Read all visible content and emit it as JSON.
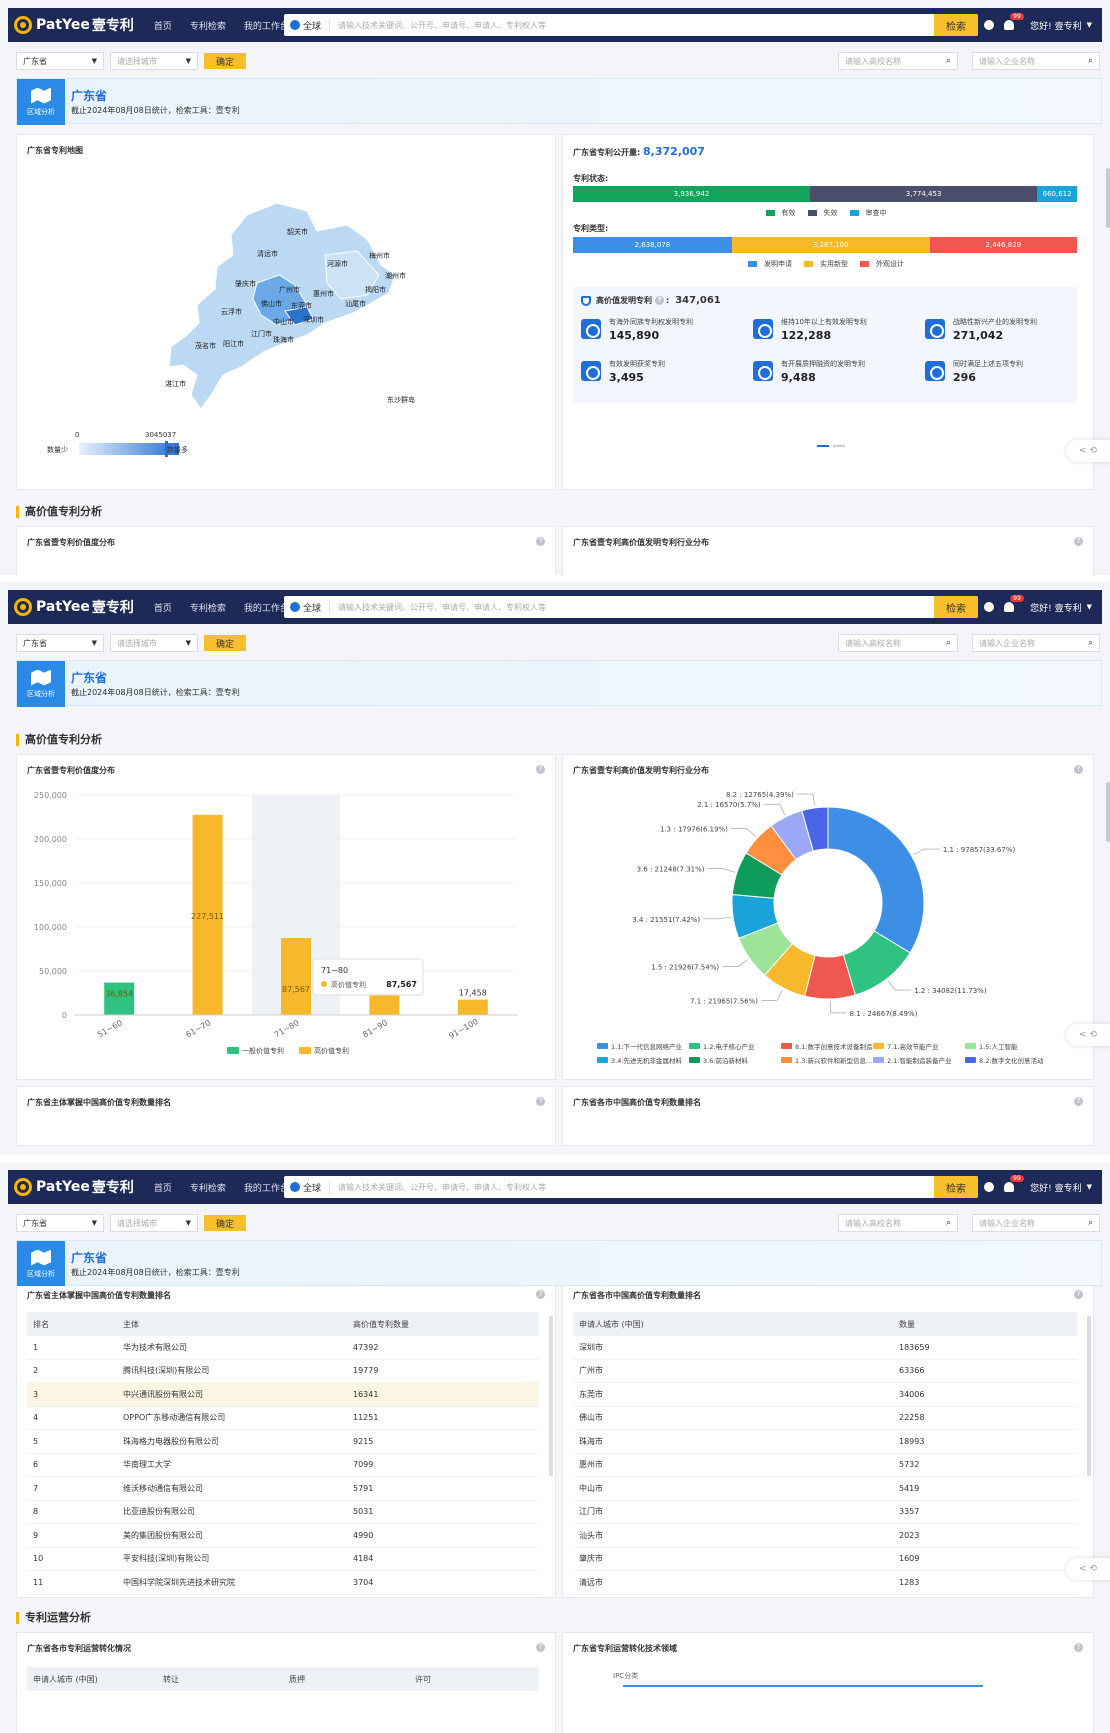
{
  "header": {
    "logo_text": "PatYee",
    "logo_cn": "壹专利",
    "nav": [
      "首页",
      "专利检索",
      "我的工作台"
    ],
    "search_scope": "全球",
    "search_placeholder": "请输入技术关键词、公开号、申请号、申请人、专利权人等",
    "search_button": "检索",
    "notify_count": "99",
    "greeting": "您好! 壹专利"
  },
  "filter": {
    "province": "广东省",
    "city_placeholder": "请选择城市",
    "confirm": "确定",
    "school_placeholder": "请输入高校名称",
    "company_placeholder": "请输入企业名称"
  },
  "banner": {
    "icon_label": "区域分析",
    "title": "广东省",
    "subtitle": "截止2024年08月08日统计，检索工具：壹专利"
  },
  "map_card": {
    "title": "广东省专利地图",
    "cities": [
      "韶关市",
      "清远市",
      "河源市",
      "梅州市",
      "潮州市",
      "肇庆市",
      "广州市",
      "惠州市",
      "揭阳市",
      "佛山市",
      "东莞市",
      "汕尾市",
      "云浮市",
      "中山市",
      "深圳市",
      "江门市",
      "珠海市",
      "茂名市",
      "阳江市",
      "湛江市",
      "东沙群岛"
    ],
    "legend_min": "0",
    "legend_max": "3045037",
    "legend_low": "数量少",
    "legend_high": "数量多"
  },
  "pub_card": {
    "title": "广东省专利公开量:",
    "total": "8,372,007",
    "status_label": "专利状态:",
    "status": [
      {
        "name": "有效",
        "value": 3936942,
        "text": "3,936,942",
        "color": "#11a55b"
      },
      {
        "name": "失效",
        "value": 3774453,
        "text": "3,774,453",
        "color": "#4c4f6b"
      },
      {
        "name": "审查中",
        "value": 660612,
        "text": "660,612",
        "color": "#1aa3d9"
      }
    ],
    "type_label": "专利类型:",
    "types": [
      {
        "name": "发明申请",
        "value": 2638078,
        "text": "2,638,078",
        "color": "#3d8fe6"
      },
      {
        "name": "实用新型",
        "value": 3287100,
        "text": "3,287,100",
        "color": "#f7b82b"
      },
      {
        "name": "外观设计",
        "value": 2446829,
        "text": "2,446,829",
        "color": "#f0574f"
      }
    ],
    "hv_title": "高价值发明专利",
    "hv_total": "347,061",
    "tiles": [
      {
        "label": "有海外同族专利权发明专利",
        "value": "145,890"
      },
      {
        "label": "维持10年以上有效发明专利",
        "value": "122,288"
      },
      {
        "label": "战略性新兴产业的发明专利",
        "value": "271,042"
      },
      {
        "label": "有效发明获奖专利",
        "value": "3,495"
      },
      {
        "label": "有开展质押融资的发明专利",
        "value": "9,488"
      },
      {
        "label": "同时满足上述五项专利",
        "value": "296"
      }
    ]
  },
  "sections": {
    "hv_analysis": "高价值专利分析",
    "ops_analysis": "专利运营分析"
  },
  "cards": {
    "value_dist": "广东省壹专利价值度分布",
    "industry_dist": "广东省壹专利高价值发明专利行业分布",
    "holder_rank": "广东省主体掌握中国高价值专利数量排名",
    "city_rank": "广东省各市中国高价值专利数量排名",
    "ops_city": "广东省各市专利运营转化情况",
    "ops_field": "广东省专利运营转化技术领域"
  },
  "float_btn": "< ⟲",
  "chart_data": [
    {
      "type": "bar",
      "title": "广东省壹专利价值度分布",
      "categories": [
        "51~60",
        "61~70",
        "71~80",
        "81~90",
        "91~100"
      ],
      "series": [
        {
          "name": "一般价值专利",
          "values": [
            36854,
            0,
            0,
            0,
            0
          ],
          "color": "#2fc281"
        },
        {
          "name": "高价值专利",
          "values": [
            0,
            227511,
            87567,
            43176,
            17458
          ],
          "color": "#f7b82b"
        }
      ],
      "bar_labels": [
        "36,854",
        "227,511",
        "87,567",
        "43,176",
        "17,458"
      ],
      "yticks": [
        "0",
        "50,000",
        "100,000",
        "150,000",
        "200,000",
        "250,000"
      ],
      "ylim": [
        0,
        250000
      ],
      "tooltip": {
        "title": "71~80",
        "label": "高价值专利",
        "value": "87,567"
      },
      "highlight_index": 2
    },
    {
      "type": "pie",
      "title": "广东省壹专利高价值发明专利行业分布",
      "slices": [
        {
          "label": "1.1 : 97857(33.67%)",
          "value": 97857,
          "color": "#3d8fe6"
        },
        {
          "label": "1.2 : 34082(11.73%)",
          "value": 34082,
          "color": "#2fc281"
        },
        {
          "label": "8.1 : 24667(8.49%)",
          "value": 24667,
          "color": "#f0574f"
        },
        {
          "label": "7.1 : 21965(7.56%)",
          "value": 21965,
          "color": "#f7b82b"
        },
        {
          "label": "1.5 : 21926(7.54%)",
          "value": 21926,
          "color": "#9ee39a"
        },
        {
          "label": "3.4 : 21551(7.42%)",
          "value": 21551,
          "color": "#1aa3d9"
        },
        {
          "label": "3.6 : 21248(7.31%)",
          "value": 21248,
          "color": "#0f9b5a"
        },
        {
          "label": "1.3 : 17976(6.19%)",
          "value": 17976,
          "color": "#ff8f3f"
        },
        {
          "label": "2.1 : 16570(5.7%)",
          "value": 16570,
          "color": "#9aa8f5"
        },
        {
          "label": "8.2 : 12765(4.39%)",
          "value": 12765,
          "color": "#4a66e6"
        }
      ],
      "legend": [
        {
          "name": "1.1:下一代信息网络产业",
          "color": "#3d8fe6"
        },
        {
          "name": "1.2:电子核心产业",
          "color": "#2fc281"
        },
        {
          "name": "8.1:数字创意技术设备制造...",
          "color": "#f0574f"
        },
        {
          "name": "7.1:高效节能产业",
          "color": "#f7b82b"
        },
        {
          "name": "1.5:人工智能",
          "color": "#9ee39a"
        },
        {
          "name": "3.4:先进无机非金属材料",
          "color": "#1aa3d9"
        },
        {
          "name": "3.6:前沿新材料",
          "color": "#0f9b5a"
        },
        {
          "name": "1.3:新兴软件和新型信息...",
          "color": "#ff8f3f"
        },
        {
          "name": "2.1:智能制造装备产业",
          "color": "#9aa8f5"
        },
        {
          "name": "8.2:数字文化创意活动",
          "color": "#4a66e6"
        }
      ]
    }
  ],
  "holder_table": {
    "headers": [
      "排名",
      "主体",
      "高价值专利数量"
    ],
    "rows": [
      [
        "1",
        "华为技术有限公司",
        "47392"
      ],
      [
        "2",
        "腾讯科技(深圳)有限公司",
        "19779"
      ],
      [
        "3",
        "中兴通讯股份有限公司",
        "16341"
      ],
      [
        "4",
        "OPPO广东移动通信有限公司",
        "11251"
      ],
      [
        "5",
        "珠海格力电器股份有限公司",
        "9215"
      ],
      [
        "6",
        "华南理工大学",
        "7099"
      ],
      [
        "7",
        "维沃移动通信有限公司",
        "5791"
      ],
      [
        "8",
        "比亚迪股份有限公司",
        "5031"
      ],
      [
        "9",
        "美的集团股份有限公司",
        "4990"
      ],
      [
        "10",
        "平安科技(深圳)有限公司",
        "4184"
      ],
      [
        "11",
        "中国科学院深圳先进技术研究院",
        "3704"
      ]
    ]
  },
  "city_table": {
    "headers": [
      "申请人城市 (中国)",
      "数量"
    ],
    "rows": [
      [
        "深圳市",
        "183659"
      ],
      [
        "广州市",
        "63366"
      ],
      [
        "东莞市",
        "34006"
      ],
      [
        "佛山市",
        "22258"
      ],
      [
        "珠海市",
        "18993"
      ],
      [
        "惠州市",
        "5732"
      ],
      [
        "中山市",
        "5419"
      ],
      [
        "江门市",
        "3357"
      ],
      [
        "汕头市",
        "2023"
      ],
      [
        "肇庆市",
        "1609"
      ],
      [
        "清远市",
        "1283"
      ]
    ]
  },
  "ops_table": {
    "headers": [
      "申请人城市 (中国)",
      "转让",
      "质押",
      "许可"
    ],
    "ipc_label": "IPC分类"
  },
  "colors": {
    "header_bg": "#1d2957",
    "accent": "#f7c02b",
    "brand_blue": "#1f6fd6"
  }
}
